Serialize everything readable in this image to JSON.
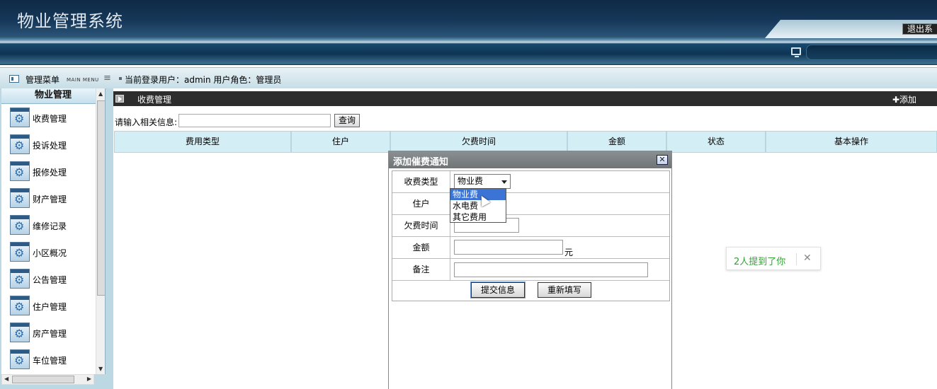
{
  "header": {
    "app_title": "物业管理系统",
    "logout_label": "退出系"
  },
  "infobar": {
    "menu_title": "管理菜单",
    "menu_title_en": "MAIN MENU",
    "user_info": "当前登录用户：admin 用户角色：管理员"
  },
  "sidebar": {
    "group_title": "物业管理",
    "items": [
      {
        "label": "收费管理",
        "icon": "gear-icon"
      },
      {
        "label": "投诉处理",
        "icon": "gear-icon"
      },
      {
        "label": "报修处理",
        "icon": "gear-icon"
      },
      {
        "label": "财产管理",
        "icon": "gear-icon"
      },
      {
        "label": "维修记录",
        "icon": "gear-icon"
      },
      {
        "label": "小区概况",
        "icon": "gear-icon"
      },
      {
        "label": "公告管理",
        "icon": "gear-icon"
      },
      {
        "label": "住户管理",
        "icon": "gear-icon"
      },
      {
        "label": "房产管理",
        "icon": "gear-icon"
      },
      {
        "label": "车位管理",
        "icon": "gear-icon"
      }
    ]
  },
  "main": {
    "title": "收费管理",
    "add_label": "✚添加",
    "search_label": "请输入相关信息:",
    "search_value": "",
    "search_button": "查询",
    "columns": [
      "费用类型",
      "住户",
      "欠费时间",
      "金额",
      "状态",
      "基本操作"
    ]
  },
  "dialog": {
    "title": "添加催费通知",
    "close": "✕",
    "fields": {
      "fee_type_label": "收费类型",
      "fee_type_value": "物业费",
      "resident_label": "住户",
      "arrear_time_label": "欠费时间",
      "amount_label": "金额",
      "amount_unit": "元",
      "remark_label": "备注"
    },
    "fee_type_options": [
      "物业费",
      "水电费",
      "其它费用"
    ],
    "submit_label": "提交信息",
    "reset_label": "重新填写"
  },
  "toast": {
    "text": "2人提到了你",
    "close": "✕"
  },
  "colors": {
    "header_dark": "#0e2a45",
    "table_head_bg": "#d4eef6",
    "toast_text": "#2fa52f",
    "selected_option": "#3b74d4"
  }
}
